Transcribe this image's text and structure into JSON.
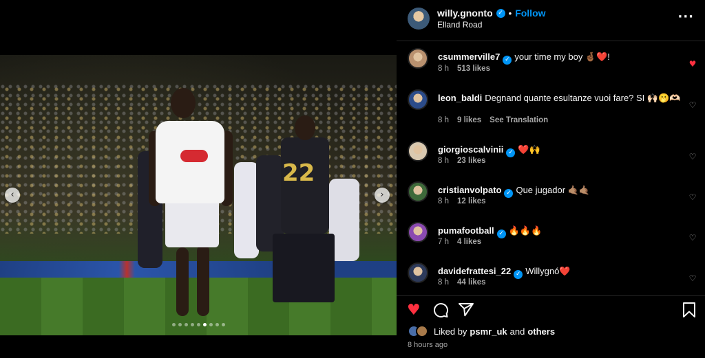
{
  "post": {
    "username": "willy.gnonto",
    "follow_label": "Follow",
    "location": "Elland Road",
    "separator": "•",
    "more_icon": "more-horizontal-icon"
  },
  "media": {
    "jersey_number": "22",
    "carousel_count": 9,
    "carousel_active_index": 5
  },
  "comments": [
    {
      "username": "csummerville7",
      "text": "your time my boy 🤞🏾❤️!",
      "verified": true,
      "time": "8 h",
      "likes": "513 likes",
      "extra": "",
      "liked": true,
      "avatar_color": "#b9916f"
    },
    {
      "username": "leon_baldi",
      "text": "Degnand quante esultanze vuoi fare? SI 🙌🏻🫢🫶🏻",
      "verified": false,
      "time": "8 h",
      "likes": "9 likes",
      "extra": "See Translation",
      "liked": false,
      "avatar_color": "#2c4c8a"
    },
    {
      "username": "giorgioscalvinii",
      "text": "❤️🙌",
      "verified": true,
      "time": "8 h",
      "likes": "23 likes",
      "extra": "",
      "liked": false,
      "avatar_color": "#d9c9b0"
    },
    {
      "username": "cristianvolpato",
      "text": "Que jugador 🤙🏽🤙🏽",
      "verified": true,
      "time": "8 h",
      "likes": "12 likes",
      "extra": "",
      "liked": false,
      "avatar_color": "#3e6a3a"
    },
    {
      "username": "pumafootball",
      "text": "🔥🔥🔥",
      "verified": true,
      "time": "7 h",
      "likes": "4 likes",
      "extra": "",
      "liked": false,
      "avatar_color": "#8a4ab0"
    },
    {
      "username": "davidefrattesi_22",
      "text": "Willygnó❤️",
      "verified": true,
      "time": "8 h",
      "likes": "44 likes",
      "extra": "",
      "liked": false,
      "avatar_color": "#2d3a5a"
    }
  ],
  "actions": {
    "like_icon": "heart-filled-icon",
    "comment_icon": "comment-icon",
    "share_icon": "share-icon",
    "save_icon": "bookmark-icon"
  },
  "likes_summary": {
    "prefix": "Liked by",
    "user": "psmr_uk",
    "middle": "and",
    "suffix": "others"
  },
  "posted_ago": "8 hours ago",
  "colors": {
    "accent": "#0095f6",
    "like_red": "#ff3040",
    "muted": "#a8a8a8"
  }
}
